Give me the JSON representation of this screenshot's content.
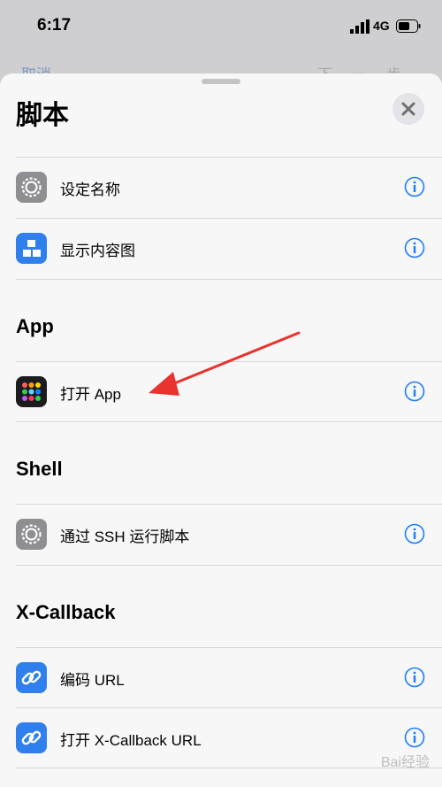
{
  "status": {
    "time": "6:17",
    "network": "4G"
  },
  "behind": {
    "left_label": "取消",
    "right_label": "下一步"
  },
  "sheet": {
    "title": "脚本",
    "rows": [
      {
        "label": "设定名称",
        "icon": "gear-icon",
        "icon_color": "#8e8e93"
      },
      {
        "label": "显示内容图",
        "icon": "content-graph-icon",
        "icon_color": "#2f80ed"
      },
      {
        "label": "打开 App",
        "icon": "app-grid-icon",
        "icon_color": "#1c1c1e"
      },
      {
        "label": "通过 SSH 运行脚本",
        "icon": "gear-icon",
        "icon_color": "#8e8e93"
      },
      {
        "label": "编码 URL",
        "icon": "link-icon",
        "icon_color": "#2f80ed"
      },
      {
        "label": "打开 X-Callback URL",
        "icon": "link-icon",
        "icon_color": "#2f80ed"
      }
    ],
    "sections": [
      "App",
      "Shell",
      "X-Callback"
    ]
  },
  "colors": {
    "accent": "#1a7cff",
    "annotation_arrow": "#e8332e"
  },
  "watermark": "Bai经验"
}
